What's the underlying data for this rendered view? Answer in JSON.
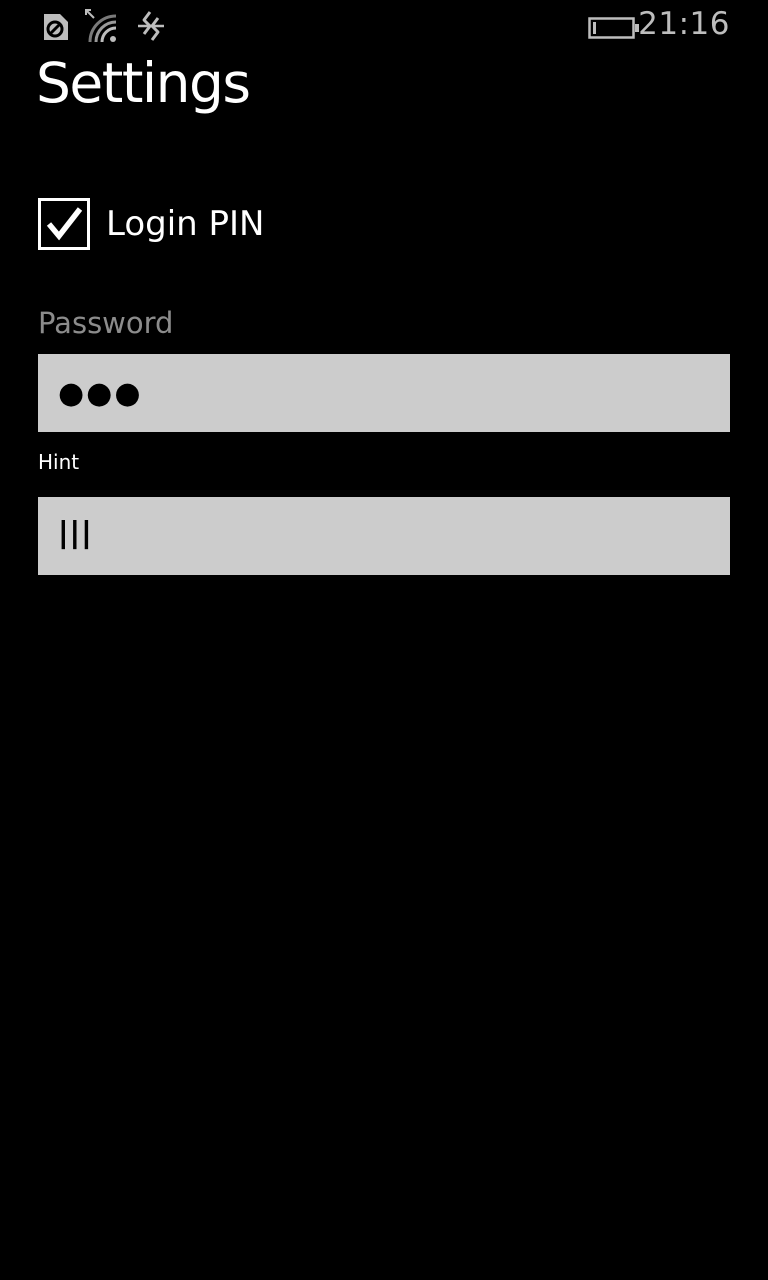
{
  "status_bar": {
    "time": "21:16",
    "icons": [
      "data-saver-icon",
      "wifi-signal-icon",
      "vibrate-icon",
      "battery-icon"
    ]
  },
  "page": {
    "title": "Settings"
  },
  "login_pin": {
    "label": "Login PIN",
    "checked": true
  },
  "password": {
    "label": "Password",
    "value": "●●●"
  },
  "hint": {
    "label": "Hint",
    "value": "lll"
  },
  "colors": {
    "background": "#000000",
    "input_background": "#cccccc",
    "label_gray": "#8c8c8c",
    "foreground": "#ffffff"
  }
}
